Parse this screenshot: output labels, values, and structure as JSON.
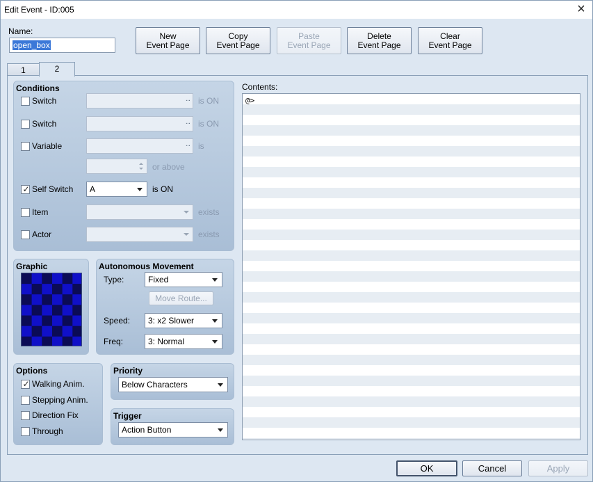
{
  "window": {
    "title": "Edit Event - ID:005"
  },
  "name": {
    "label": "Name:",
    "value": "open_box"
  },
  "toolbar": {
    "new_line1": "New",
    "new_line2": "Event Page",
    "copy_line1": "Copy",
    "copy_line2": "Event Page",
    "paste_line1": "Paste",
    "paste_line2": "Event Page",
    "delete_line1": "Delete",
    "delete_line2": "Event Page",
    "clear_line1": "Clear",
    "clear_line2": "Event Page"
  },
  "tabs": [
    {
      "label": "1",
      "active": false
    },
    {
      "label": "2",
      "active": true
    }
  ],
  "conditions": {
    "title": "Conditions",
    "switch1": {
      "label": "Switch",
      "checked": false,
      "dots": "...",
      "suffix": "is ON"
    },
    "switch2": {
      "label": "Switch",
      "checked": false,
      "dots": "...",
      "suffix": "is ON"
    },
    "variable": {
      "label": "Variable",
      "checked": false,
      "dots": "...",
      "suffix": "is",
      "above": "or above"
    },
    "self_switch": {
      "label": "Self Switch",
      "checked": true,
      "value": "A",
      "suffix": "is ON",
      "check": "✓"
    },
    "item": {
      "label": "Item",
      "checked": false,
      "suffix": "exists"
    },
    "actor": {
      "label": "Actor",
      "checked": false,
      "suffix": "exists"
    }
  },
  "graphic": {
    "title": "Graphic",
    "colors": {
      "dark": "#0b0b55",
      "light": "#1010c8"
    }
  },
  "movement": {
    "title": "Autonomous Movement",
    "type_label": "Type:",
    "type_value": "Fixed",
    "move_route": "Move Route...",
    "speed_label": "Speed:",
    "speed_value": "3: x2 Slower",
    "freq_label": "Freq:",
    "freq_value": "3: Normal"
  },
  "options": {
    "title": "Options",
    "walking": {
      "label": "Walking Anim.",
      "checked": true,
      "check": "✓"
    },
    "stepping": {
      "label": "Stepping Anim.",
      "checked": false
    },
    "direction_fix": {
      "label": "Direction Fix",
      "checked": false
    },
    "through": {
      "label": "Through",
      "checked": false
    }
  },
  "priority": {
    "title": "Priority",
    "value": "Below Characters"
  },
  "trigger": {
    "title": "Trigger",
    "value": "Action Button"
  },
  "contents": {
    "label": "Contents:",
    "rows": [
      "@>"
    ]
  },
  "footer": {
    "ok": "OK",
    "cancel": "Cancel",
    "apply": "Apply"
  },
  "icons": {
    "close": "×"
  }
}
